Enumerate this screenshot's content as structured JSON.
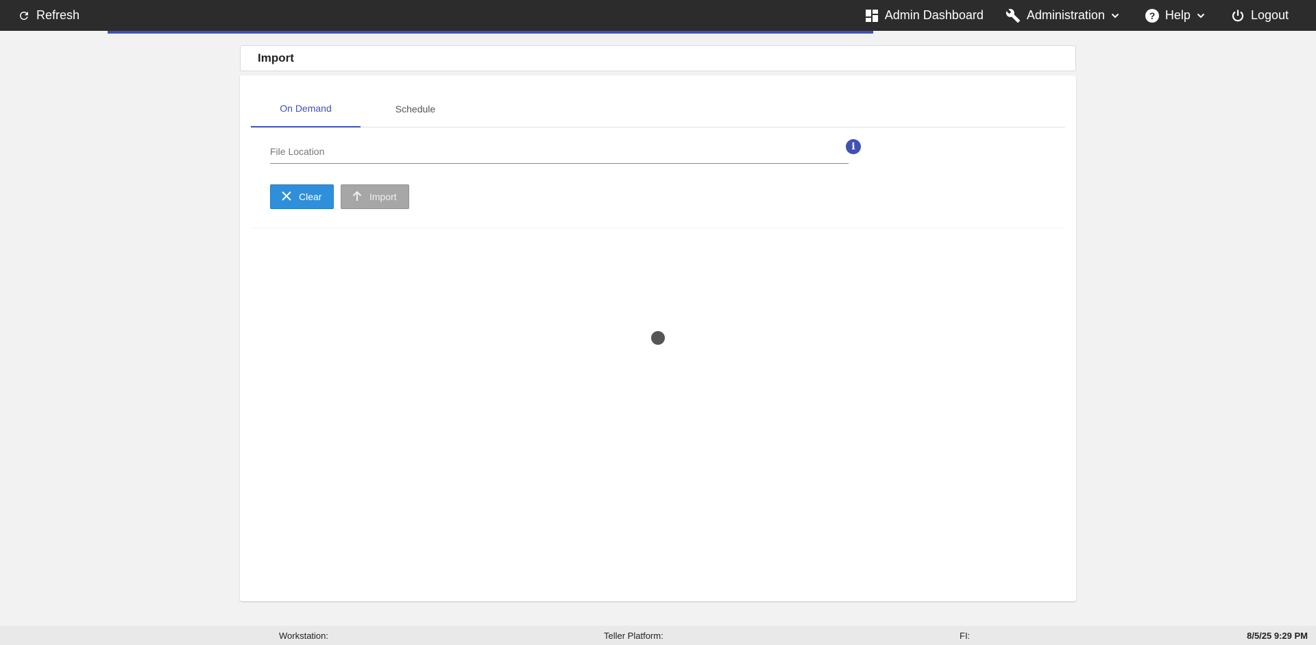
{
  "topbar": {
    "refresh_label": "Refresh",
    "admin_dashboard_label": "Admin Dashboard",
    "administration_label": "Administration",
    "help_label": "Help",
    "logout_label": "Logout"
  },
  "header": {
    "title": "Import"
  },
  "tabs": [
    {
      "label": "On Demand",
      "active": true
    },
    {
      "label": "Schedule",
      "active": false
    }
  ],
  "form": {
    "file_location_placeholder": "File Location",
    "file_location_value": "",
    "info_glyph": "i"
  },
  "buttons": {
    "clear_label": "Clear",
    "import_label": "Import"
  },
  "statusbar": {
    "workstation_label": "Workstation:",
    "teller_platform_label": "Teller Platform:",
    "fi_label": "FI:",
    "datetime": "8/5/25 9:29 PM"
  },
  "colors": {
    "topbar_bg": "#2c2c2c",
    "accent": "#3f51b5",
    "clear_button": "#2f8fdb",
    "import_button_disabled": "#a6a6a6"
  },
  "icons": {
    "refresh": "refresh-icon",
    "dashboard": "dashboard-icon",
    "administration": "wrench-icon",
    "help": "help-icon",
    "logout": "power-icon",
    "info": "info-icon",
    "clear": "close-icon",
    "import": "arrow-up-icon"
  }
}
